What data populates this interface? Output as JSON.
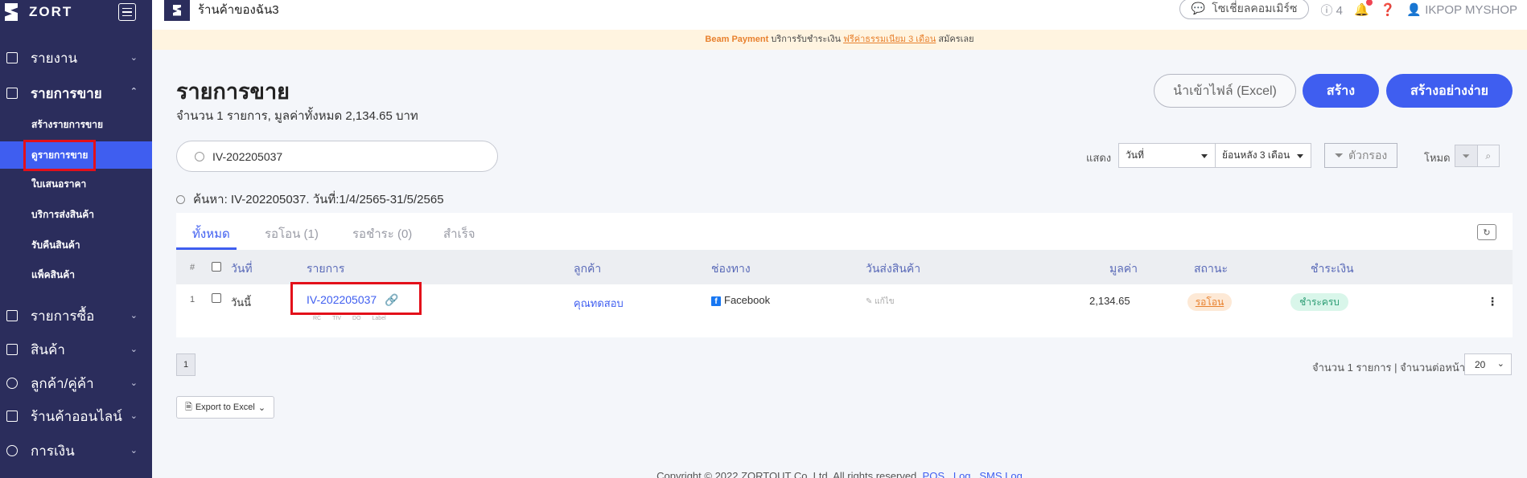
{
  "brand": {
    "name": "ZORT"
  },
  "sidebar": {
    "items": [
      {
        "label": "รายงาน"
      },
      {
        "label": "รายการขาย"
      },
      {
        "label": "รายการซื้อ"
      },
      {
        "label": "สินค้า"
      },
      {
        "label": "ลูกค้า/คู่ค้า"
      },
      {
        "label": "ร้านค้าออนไลน์"
      },
      {
        "label": "การเงิน"
      }
    ],
    "sub_items": [
      {
        "label": "สร้างรายการขาย"
      },
      {
        "label": "ดูรายการขาย"
      },
      {
        "label": "ใบเสนอราคา"
      },
      {
        "label": "บริการส่งสินค้า"
      },
      {
        "label": "รับคืนสินค้า"
      },
      {
        "label": "แพ็คสินค้า"
      }
    ]
  },
  "topbar": {
    "store_name": "ร้านค้าของฉัน3",
    "connect_label": "โซเชี่ยลคอมเมิร์ซ",
    "info_count": "4",
    "user": "IKPOP MYSHOP"
  },
  "promo": {
    "brand": "Beam Payment",
    "text": "บริการรับชำระเงิน",
    "link": "ฟรีค่าธรรมเนียม 3 เดือน",
    "cta": "สมัครเลย"
  },
  "page": {
    "title": "รายการขาย",
    "subtitle": "จำนวน 1 รายการ, มูลค่าทั้งหมด 2,134.65 บาท",
    "btn_import": "นำเข้าไฟล์ (Excel)",
    "btn_create": "สร้าง",
    "btn_quick_create": "สร้างอย่างง่าย"
  },
  "filters": {
    "search_value": "IV-202205037",
    "show_label": "แสดง",
    "date_field": "วันที่",
    "date_range": "ย้อนหลัง 3 เดือน",
    "filter_btn": "ตัวกรอง",
    "mode_label": "โหมด",
    "summary": "ค้นหา: IV-202205037. วันที่:1/4/2565-31/5/2565"
  },
  "tabs": [
    "ทั้งหมด",
    "รอโอน (1)",
    "รอชำระ (0)",
    "สำเร็จ"
  ],
  "table": {
    "headers": {
      "num": "#",
      "date": "วันที่",
      "item": "รายการ",
      "customer": "ลูกค้า",
      "channel": "ช่องทาง",
      "ship_date": "วันส่งสินค้า",
      "value": "มูลค่า",
      "status": "สถานะ",
      "payment": "ชำระเงิน"
    },
    "rows": [
      {
        "num": "1",
        "date": "วันนี้",
        "invoice": "IV-202205037",
        "tags": [
          "RC",
          "TIV",
          "DO",
          "Label"
        ],
        "customer": "คุณทดสอบ",
        "channel": "Facebook",
        "ship_date": "แก้ไข",
        "value": "2,134.65",
        "status": "รอโอน",
        "payment": "ชำระครบ"
      }
    ]
  },
  "pagination": {
    "page": "1",
    "summary": "จำนวน 1 รายการ | จำนวนต่อหน้า",
    "per_page": "20"
  },
  "export_label": "Export to Excel",
  "footer": {
    "text": "Copyright © 2022 ZORTOUT Co.,Ltd. All rights reserved.",
    "links": [
      "POS",
      "Log",
      "SMS Log"
    ]
  },
  "colors": {
    "sidebar_bg": "#2b2d5c",
    "accent": "#3f5ef0",
    "highlight_red": "#e3101a",
    "status_wait": "#e8812e",
    "status_paid": "#2c9d74"
  }
}
